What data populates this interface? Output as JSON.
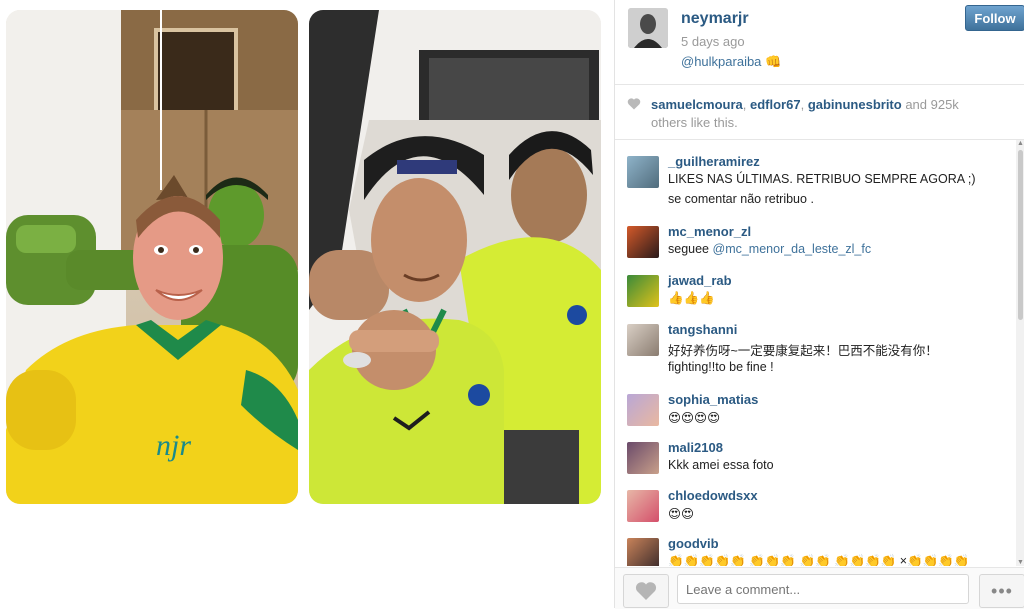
{
  "post": {
    "username": "neymarjr",
    "timestamp": "5 days ago",
    "caption": "@hulkparaiba 👊",
    "follow_label": "Follow"
  },
  "likes": {
    "names": [
      "samuelcmoura",
      "edflor67",
      "gabinunesbrito"
    ],
    "sep1": ", ",
    "sep2": ", ",
    "and_count": " and 925k",
    "line2": "others like this."
  },
  "photos": {
    "left_shirt_text": "njr"
  },
  "comments": [
    {
      "user": "_guilheramirez",
      "text": "LIKES NAS ÚLTIMAS. RETRIBUO SEMPRE AGORA ;)",
      "text2": "se comentar não retribuo ."
    },
    {
      "user": "mc_menor_zl",
      "text": "seguee",
      "mention": "@mc_menor_da_leste_zl_fc"
    },
    {
      "user": "jawad_rab",
      "text": "👍👍👍"
    },
    {
      "user": "tangshanni",
      "text": "好好养伤呀~一定要康复起来！巴西不能没有你！",
      "text2": "fighting!!to be fine !"
    },
    {
      "user": "sophia_matias",
      "text": "😍😍😍😍"
    },
    {
      "user": "mali2108",
      "text": "Kkk amei essa foto"
    },
    {
      "user": "chloedowdsxx",
      "text": "😍😍"
    },
    {
      "user": "goodvib",
      "text": "👏👏👏👏👏 👏👏👏 👏👏 👏👏👏👏 ×👏👏👏👏"
    }
  ],
  "footer": {
    "comment_placeholder": "Leave a comment...",
    "more_label": "•••"
  },
  "colors": {
    "link": "#2b5a83",
    "follow_button": "#3f729b"
  },
  "icons": [
    "heart-icon",
    "more-icon"
  ]
}
